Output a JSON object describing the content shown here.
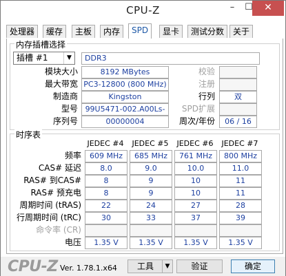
{
  "window": {
    "title": "CPU-Z",
    "min_icon": "minimize-icon",
    "max_icon": "maximize-icon",
    "close_icon": "close-icon",
    "min_glyph": "–",
    "max_glyph": "☐",
    "close_glyph": "✕"
  },
  "tabs": [
    "处理器",
    "缓存",
    "主板",
    "内存",
    "SPD",
    "显卡",
    "测试分数",
    "关于"
  ],
  "active_tab": "SPD",
  "slot_group": {
    "label": "内存插槽选择",
    "slot_select": "插槽 #1",
    "module_type": "DDR3",
    "module_size_label": "模块大小",
    "module_size": "8192 MBytes",
    "max_bandwidth_label": "最大带宽",
    "max_bandwidth": "PC3-12800 (800 MHz)",
    "manufacturer_label": "制造商",
    "manufacturer": "Kingston",
    "part_number_label": "型号",
    "part_number": "99U5471-002.A00Ls-",
    "serial_number_label": "序列号",
    "serial_number": "00000004",
    "correction_label": "校验",
    "correction": "",
    "registered_label": "注册",
    "registered": "",
    "ranks_label": "行列",
    "ranks": "双",
    "spd_ext_label": "SPD扩展",
    "spd_ext": "",
    "week_year_label": "周次/年份",
    "week_year": "06 / 16"
  },
  "timings": {
    "label": "时序表",
    "columns": [
      "JEDEC #4",
      "JEDEC #5",
      "JEDEC #6",
      "JEDEC #7"
    ],
    "rows": [
      {
        "label": "频率",
        "values": [
          "609 MHz",
          "685 MHz",
          "761 MHz",
          "800 MHz"
        ],
        "dim": false
      },
      {
        "label": "CAS# 延迟",
        "values": [
          "8.0",
          "9.0",
          "10.0",
          "11.0"
        ],
        "dim": false
      },
      {
        "label": "RAS# 到CAS#",
        "values": [
          "8",
          "9",
          "10",
          "11"
        ],
        "dim": false
      },
      {
        "label": "RAS# 预充电",
        "values": [
          "8",
          "9",
          "10",
          "11"
        ],
        "dim": false
      },
      {
        "label": "周期时间 (tRAS)",
        "values": [
          "22",
          "24",
          "27",
          "28"
        ],
        "dim": false
      },
      {
        "label": "行周期时间 (tRC)",
        "values": [
          "30",
          "33",
          "37",
          "39"
        ],
        "dim": false
      },
      {
        "label": "命令率 (CR)",
        "values": [
          "",
          "",
          "",
          ""
        ],
        "dim": true
      },
      {
        "label": "电压",
        "values": [
          "1.35 V",
          "1.35 V",
          "1.35 V",
          "1.35 V"
        ],
        "dim": false
      }
    ]
  },
  "bottom": {
    "logo": "CPU-Z",
    "version": "Ver. 1.78.1.x64",
    "tools_label": "工具",
    "validate_label": "验证",
    "ok_label": "确定"
  },
  "colors": {
    "value_text": "#1c3fa0",
    "close_button": "#c75050",
    "active_tab_text": "#1d58a6"
  }
}
